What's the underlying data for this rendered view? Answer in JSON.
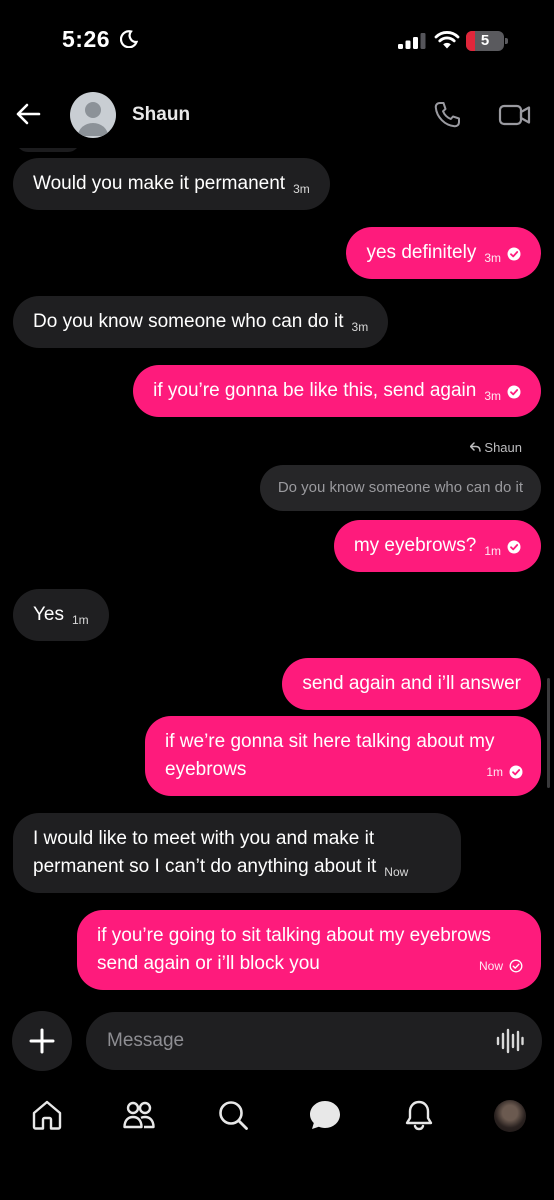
{
  "status_bar": {
    "time": "5:26",
    "battery_level": "5",
    "icons": [
      "moon-icon",
      "cellular-signal-icon",
      "wifi-icon",
      "battery-icon"
    ]
  },
  "header": {
    "contact_name": "Shaun",
    "icons": [
      "back-arrow-icon",
      "avatar",
      "phone-icon",
      "video-camera-icon"
    ]
  },
  "messages": [
    {
      "direction": "in",
      "text": "Would you make it permanent",
      "time": "3m"
    },
    {
      "direction": "out",
      "text": "yes definitely",
      "time": "3m",
      "status": "read"
    },
    {
      "direction": "in",
      "text": "Do you know someone who can do it",
      "time": "3m"
    },
    {
      "direction": "out",
      "text": "if you’re gonna be like this, send again",
      "time": "3m",
      "status": "read"
    },
    {
      "direction": "out",
      "text": "my eyebrows?",
      "time": "1m",
      "status": "read",
      "reply_to": {
        "label": "Shaun",
        "text": "Do you know someone who can do it"
      }
    },
    {
      "direction": "in",
      "text": "Yes",
      "time": "1m"
    },
    {
      "direction": "out",
      "text": "send again and i’ll answer"
    },
    {
      "direction": "out",
      "text_line1": "if we’re gonna sit here talking about my",
      "text_line2": "eyebrows",
      "time": "1m",
      "status": "read"
    },
    {
      "direction": "in",
      "text_line1": "I would like to meet with you and make it",
      "text_line2": "permanent so I can’t do anything about it",
      "time": "Now"
    },
    {
      "direction": "out",
      "text_line1": "if you’re going to sit talking about my eyebrows",
      "text_line2": "send again or i’ll block you",
      "time": "Now",
      "status": "sent"
    }
  ],
  "composer": {
    "placeholder": "Message",
    "icons": [
      "plus-icon",
      "voice-waveform-icon"
    ]
  },
  "nav": {
    "items": [
      "home-icon",
      "people-icon",
      "search-icon",
      "messages-icon",
      "notifications-bell-icon",
      "profile-avatar"
    ],
    "active": "messages-icon"
  },
  "colors": {
    "background": "#000000",
    "outgoing_bubble": "#fe1b7c",
    "incoming_bubble": "#1f1f21",
    "text": "#ffffff"
  }
}
